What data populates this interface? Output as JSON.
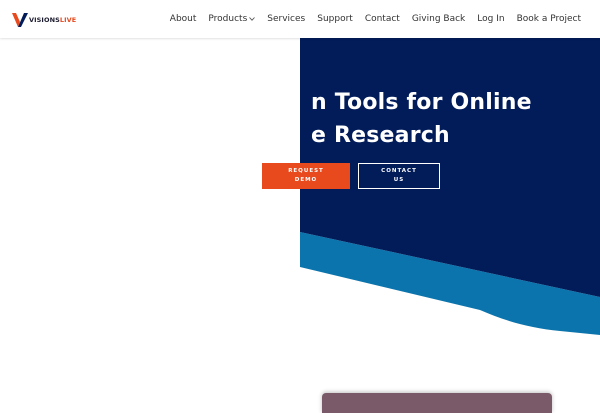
{
  "brand": {
    "logo_word_1": "VISIONS",
    "logo_word_2": "LIVE",
    "orange": "#e8491d",
    "navy": "#021c5a",
    "blue": "#0b74ad"
  },
  "nav": {
    "items": [
      "About",
      "Products",
      "Services",
      "Support",
      "Contact",
      "Giving Back",
      "Log In",
      "Book a Project"
    ],
    "products_icon": "chevron-down-icon"
  },
  "hero": {
    "title_line_1": "n Tools for Online",
    "title_line_2": "e Research",
    "request_demo_label": "REQUEST\nDEMO",
    "contact_us_label": "CONTACT\nUS"
  }
}
